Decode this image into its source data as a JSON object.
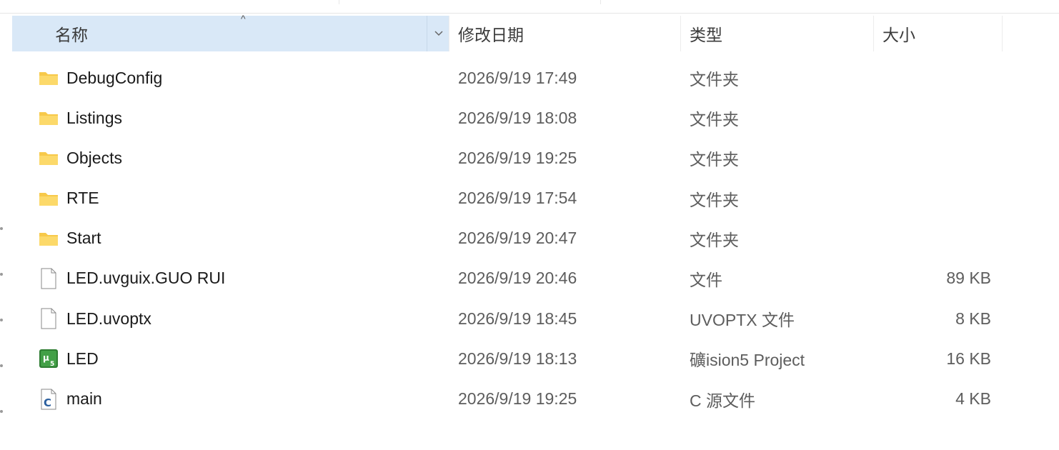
{
  "columns": {
    "name": "名称",
    "date": "修改日期",
    "type": "类型",
    "size": "大小",
    "sort_indicator": "^"
  },
  "files": [
    {
      "name": "DebugConfig",
      "date": "2026/9/19 17:49",
      "type": "文件夹",
      "size": "",
      "icon": "folder-icon"
    },
    {
      "name": "Listings",
      "date": "2026/9/19 18:08",
      "type": "文件夹",
      "size": "",
      "icon": "folder-icon"
    },
    {
      "name": "Objects",
      "date": "2026/9/19 19:25",
      "type": "文件夹",
      "size": "",
      "icon": "folder-icon"
    },
    {
      "name": "RTE",
      "date": "2026/9/19 17:54",
      "type": "文件夹",
      "size": "",
      "icon": "folder-icon"
    },
    {
      "name": "Start",
      "date": "2026/9/19 20:47",
      "type": "文件夹",
      "size": "",
      "icon": "folder-icon"
    },
    {
      "name": "LED.uvguix.GUO RUI",
      "date": "2026/9/19 20:46",
      "type": "文件",
      "size": "89 KB",
      "icon": "file-icon"
    },
    {
      "name": "LED.uvoptx",
      "date": "2026/9/19 18:45",
      "type": "UVOPTX 文件",
      "size": "8 KB",
      "icon": "file-icon"
    },
    {
      "name": "LED",
      "date": "2026/9/19 18:13",
      "type": "礦ision5 Project",
      "size": "16 KB",
      "icon": "uvision-project-icon"
    },
    {
      "name": "main",
      "date": "2026/9/19 19:25",
      "type": "C 源文件",
      "size": "4 KB",
      "icon": "c-source-icon"
    }
  ],
  "colors": {
    "header_selected_bg": "#d9e8f7",
    "folder": "#f7c94a",
    "uvision_green": "#2e7d32",
    "c_blue": "#2b5f9e"
  }
}
